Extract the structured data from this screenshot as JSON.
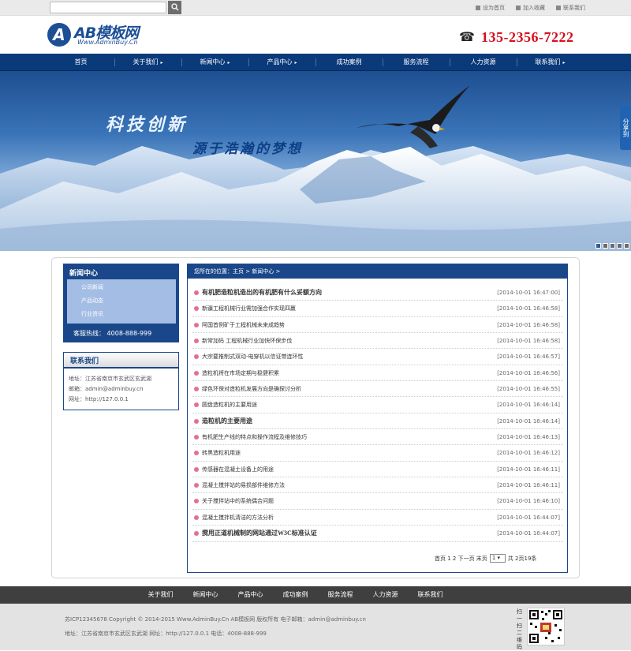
{
  "topbar": {
    "search_placeholder": "",
    "links": [
      "设为首页",
      "加入收藏",
      "联系我们"
    ]
  },
  "header": {
    "logo_text": "AB模板网",
    "logo_sub": "Www.AdminBuy.Cn",
    "phone": "135-2356-7222"
  },
  "nav": {
    "items": [
      {
        "label": "首页",
        "arrow": false
      },
      {
        "label": "关于我们",
        "arrow": true
      },
      {
        "label": "新闻中心",
        "arrow": true
      },
      {
        "label": "产品中心",
        "arrow": true
      },
      {
        "label": "成功案例",
        "arrow": false
      },
      {
        "label": "服务流程",
        "arrow": false
      },
      {
        "label": "人力资源",
        "arrow": false
      },
      {
        "label": "联系我们",
        "arrow": true
      }
    ]
  },
  "banner": {
    "title": "科技创新",
    "subtitle": "源于浩瀚的梦想",
    "share": "分享到"
  },
  "sidebar": {
    "news_title": "新闻中心",
    "news_items": [
      "公司新闻",
      "产品动态",
      "行业资讯"
    ],
    "hotline_label": "客服热线：",
    "hotline": "4008-888-999",
    "contact_title": "联系我们",
    "contact_lines": [
      "地址：江苏省南京市玄武区玄武湖",
      "邮箱：admin@adminbuy.cn",
      "网址：http://127.0.0.1"
    ]
  },
  "main": {
    "breadcrumb": "您所在的位置：主页 > 新闻中心 >",
    "news": [
      {
        "title": "有机肥造粒机造出的有机肥有什么妥额方向",
        "date": "[2014-10-01 16:47:00]",
        "bold": true
      },
      {
        "title": "新疆工程机械行业需加强合作实现四赢",
        "date": "[2014-10-01 16:46:58]",
        "bold": false
      },
      {
        "title": "阿国首例矿于工程机械未来成趋势",
        "date": "[2014-10-01 16:46:58]",
        "bold": false
      },
      {
        "title": "新常加码 工程机械行业加快环保步伐",
        "date": "[2014-10-01 16:46:58]",
        "bold": false
      },
      {
        "title": "大宗要推制式双动-电穿机以信证带连环性",
        "date": "[2014-10-01 16:46:57]",
        "bold": false
      },
      {
        "title": "造粒机将在市场定期与稳健积累",
        "date": "[2014-10-01 16:46:56]",
        "bold": false
      },
      {
        "title": "绿色环保对造粒机发展方向是确探讨分析",
        "date": "[2014-10-01 16:46:55]",
        "bold": false
      },
      {
        "title": "圆盘造粒机的主要用途",
        "date": "[2014-10-01 16:46:14]",
        "bold": false
      },
      {
        "title": "造粒机的主要用途",
        "date": "[2014-10-01 16:46:14]",
        "bold": true
      },
      {
        "title": "有机肥生产线的特点和操作流程及维修技巧",
        "date": "[2014-10-01 16:46:13]",
        "bold": false
      },
      {
        "title": "转黑造粒机用途",
        "date": "[2014-10-01 16:46:12]",
        "bold": false
      },
      {
        "title": "传感器在混凝土设备上的用途",
        "date": "[2014-10-01 16:46:11]",
        "bold": false
      },
      {
        "title": "混凝土搅拌站的易损部件维修方法",
        "date": "[2014-10-01 16:46:11]",
        "bold": false
      },
      {
        "title": "关于搅拌站中的系统偶合问题",
        "date": "[2014-10-01 16:46:10]",
        "bold": false
      },
      {
        "title": "混凝土搅拌机清洁的方法分析",
        "date": "[2014-10-01 16:44:07]",
        "bold": false
      },
      {
        "title": "搅用正道机械制的网站通过W3C标准认证",
        "date": "[2014-10-01 16:44:07]",
        "bold": true
      }
    ],
    "pager": {
      "prefix": "首页 1 2  下一页  末页",
      "select": "1",
      "suffix": "共 2页19条"
    }
  },
  "footer_nav": [
    "关于我们",
    "新闻中心",
    "产品中心",
    "成功案例",
    "服务流程",
    "人力资源",
    "联系我们"
  ],
  "footer": {
    "line1": "苏ICP12345678   Copyright © 2014-2015 Www.AdminBuy.Cn AB模板网 版权所有    电子邮箱：admin@adminbuy.cn",
    "line2": "地址：江苏省南京市玄武区玄武湖      网址：http://127.0.0.1    电话：4008-888-999",
    "qr_label": "扫一扫二维码"
  }
}
